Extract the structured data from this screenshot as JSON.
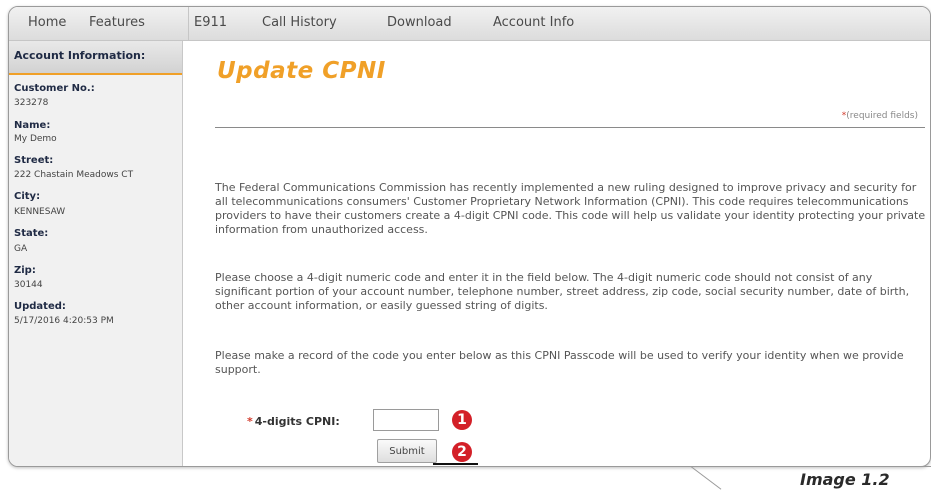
{
  "nav": {
    "items": [
      "Home",
      "Features",
      "E911",
      "Call History",
      "Download",
      "Account Info"
    ]
  },
  "sidebar": {
    "heading": "Account Information:",
    "fields": [
      {
        "label": "Customer No.:",
        "value": "323278"
      },
      {
        "label": "Name:",
        "value": "My Demo"
      },
      {
        "label": "Street:",
        "value": "222 Chastain Meadows CT"
      },
      {
        "label": "City:",
        "value": "KENNESAW"
      },
      {
        "label": "State:",
        "value": "GA"
      },
      {
        "label": "Zip:",
        "value": "30144"
      },
      {
        "label": "Updated:",
        "value": "5/17/2016 4:20:53 PM"
      }
    ]
  },
  "main": {
    "title": "Update CPNI",
    "required_star": "*",
    "required_note": "(required fields)",
    "paragraphs": [
      "The Federal Communications Commission has recently implemented a new ruling designed to improve privacy and security for all telecommunications consumers' Customer Proprietary Network Information (CPNI). This code requires telecommunications providers to have their customers create a 4-digit CPNI code. This code will help us validate your identity protecting your private information from unauthorized access.",
      "Please choose a 4-digit numeric code and enter it in the field below. The 4-digit numeric code should not consist of any significant portion of your account number, telephone number, street address, zip code, social security number, date of birth, other account information, or easily guessed string of digits.",
      "Please make a record of the code you enter below as this CPNI Passcode will be used to verify your identity when we provide support."
    ],
    "form": {
      "required_star": "*",
      "cpni_label": "4-digits CPNI:",
      "cpni_value": "",
      "submit_label": "Submit"
    }
  },
  "annotations": {
    "marker_1": "1",
    "marker_2": "2",
    "caption": "Image 1.2",
    "marker_color": "#d32028"
  },
  "colors": {
    "title_orange": "#f0a028",
    "required_red": "#d23b2c"
  }
}
